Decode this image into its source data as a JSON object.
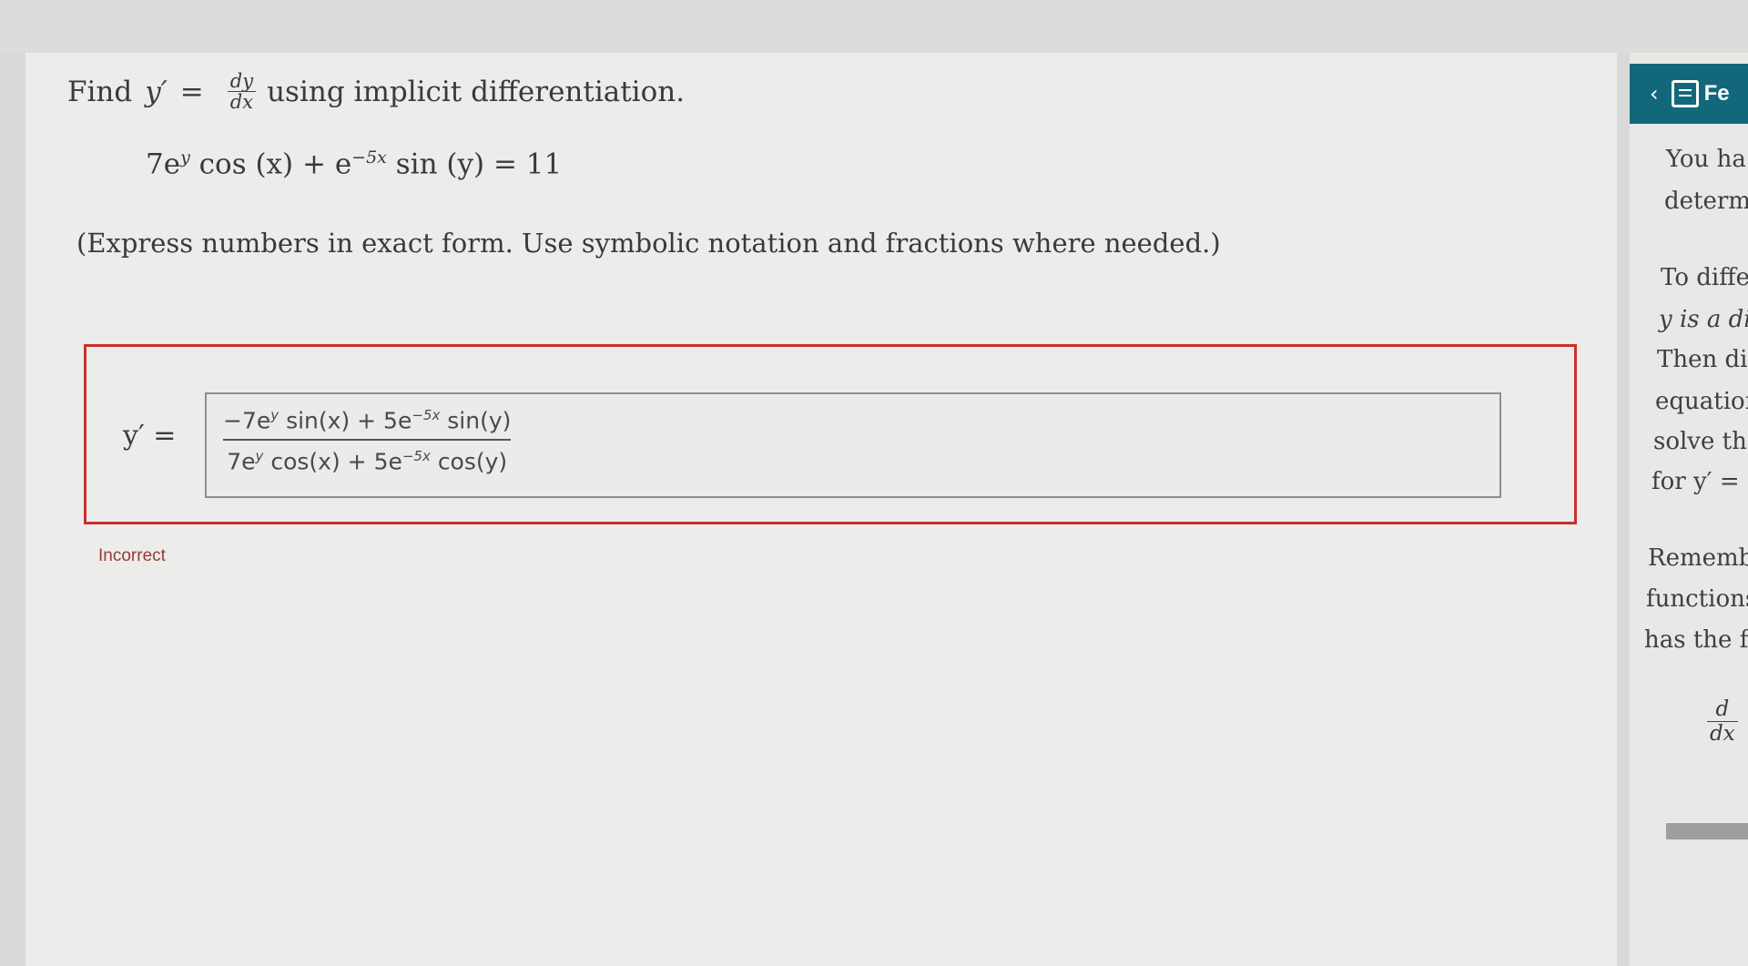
{
  "question": {
    "find_word": "Find",
    "lhs_var": "y′",
    "equals": "=",
    "dy": "dy",
    "dx": "dx",
    "prompt_rest": "using implicit differentiation.",
    "equation": {
      "t1_coef": "7e",
      "t1_exp": "y",
      "t1_trig": "cos (x) + e",
      "t2_exp": "−5x",
      "t2_trig": "sin (y) = 11"
    },
    "instructions": "(Express numbers in exact form. Use symbolic notation and fractions where needed.)"
  },
  "answer": {
    "label": "y′ =",
    "numerator": {
      "a": "−7e",
      "a_exp": "y",
      "b": "sin(x) + 5e",
      "b_exp": "−5x",
      "c": "sin(y)"
    },
    "denominator": {
      "a": "7e",
      "a_exp": "y",
      "b": "cos(x) + 5e",
      "b_exp": "−5x",
      "c": "cos(y)"
    },
    "status": "Incorrect"
  },
  "feedback_panel": {
    "chevron": "‹",
    "title": "Fe",
    "icon": "feedback-icon",
    "lines": [
      "You ha",
      "determi",
      "To diffe",
      "y is a di",
      "Then dif",
      "equation",
      "solve the",
      "for y′ =",
      "Rememb",
      "functions",
      "has the fo"
    ],
    "frac_num": "d",
    "frac_den": "dx"
  },
  "colors": {
    "accent": "#12687a",
    "error": "#c8302e"
  }
}
